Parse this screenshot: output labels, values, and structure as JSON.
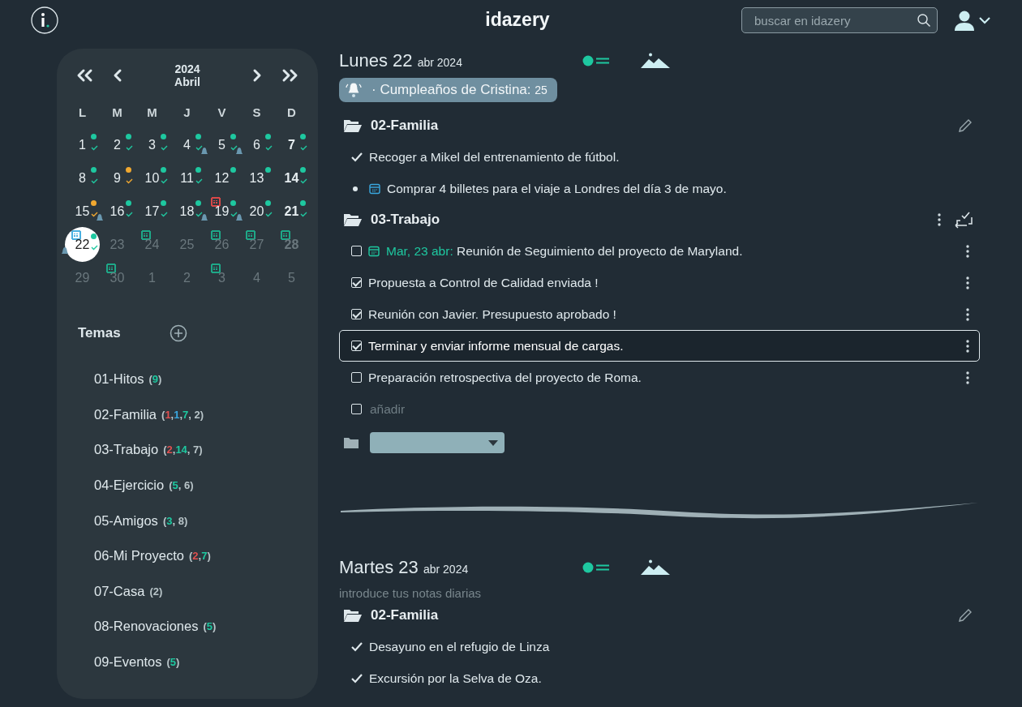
{
  "header": {
    "logo": "idazery",
    "search": {
      "placeholder": "buscar en idazery"
    }
  },
  "calendar": {
    "year": "2024",
    "month": "Abril",
    "weekdays": [
      "L",
      "M",
      "M",
      "J",
      "V",
      "S",
      "D"
    ],
    "days": [
      {
        "day": "1",
        "selected": false,
        "bold": false,
        "dim": false,
        "color": "#1ec8a0",
        "check": true,
        "bell": false
      },
      {
        "day": "2",
        "selected": false,
        "bold": false,
        "dim": false,
        "color": "#1ec8a0",
        "check": true,
        "bell": false
      },
      {
        "day": "3",
        "selected": false,
        "bold": false,
        "dim": false,
        "color": "#1ec8a0",
        "check": true,
        "bell": false
      },
      {
        "day": "4",
        "selected": false,
        "bold": false,
        "dim": false,
        "color": "#1ec8a0",
        "check": true,
        "bell": false
      },
      {
        "day": "5",
        "selected": false,
        "bold": false,
        "dim": false,
        "color": "#1ec8a0",
        "check": true,
        "bell": true
      },
      {
        "day": "6",
        "selected": false,
        "bold": false,
        "dim": false,
        "color": "#1ec8a0",
        "check": true,
        "bell": true
      },
      {
        "day": "7",
        "selected": false,
        "bold": true,
        "dim": false,
        "color": "#1ec8a0",
        "check": true,
        "bell": false
      },
      {
        "day": "8",
        "selected": false,
        "bold": false,
        "dim": false,
        "color": "#1ec8a0",
        "check": true,
        "bell": false
      },
      {
        "day": "9",
        "selected": false,
        "bold": false,
        "dim": false,
        "color": "#f0a830",
        "check": true,
        "bell": false
      },
      {
        "day": "10",
        "selected": false,
        "bold": false,
        "dim": false,
        "color": "#1ec8a0",
        "check": true,
        "bell": false
      },
      {
        "day": "11",
        "selected": false,
        "bold": false,
        "dim": false,
        "color": "#1ec8a0",
        "check": true,
        "bell": false
      },
      {
        "day": "12",
        "selected": false,
        "bold": false,
        "dim": false,
        "color": "#1ec8a0",
        "check": false,
        "bell": false
      },
      {
        "day": "13",
        "selected": false,
        "bold": false,
        "dim": false,
        "color": "#1ec8a0",
        "check": false,
        "bell": false
      },
      {
        "day": "14",
        "selected": false,
        "bold": true,
        "dim": false,
        "color": "#1ec8a0",
        "check": true,
        "bell": false
      },
      {
        "day": "15",
        "selected": false,
        "bold": false,
        "dim": false,
        "color": "#f0a830",
        "check": true,
        "bell": false
      },
      {
        "day": "16",
        "selected": false,
        "bold": false,
        "dim": false,
        "color": "#1ec8a0",
        "check": true,
        "bell": true
      },
      {
        "day": "17",
        "selected": false,
        "bold": false,
        "dim": false,
        "color": "#1ec8a0",
        "check": true,
        "bell": false
      },
      {
        "day": "18",
        "selected": false,
        "bold": false,
        "dim": false,
        "color": "#1ec8a0",
        "check": true,
        "bell": false
      },
      {
        "day": "19",
        "selected": false,
        "bold": false,
        "dim": false,
        "color": "#1ec8a0",
        "check": true,
        "bell": true,
        "note": {
          "color": "#d84848"
        }
      },
      {
        "day": "20",
        "selected": false,
        "bold": false,
        "dim": false,
        "color": "#1ec8a0",
        "check": true,
        "bell": true
      },
      {
        "day": "21",
        "selected": false,
        "bold": true,
        "dim": false,
        "color": "#1ec8a0",
        "check": true,
        "bell": false
      },
      {
        "day": "22",
        "selected": true,
        "bold": false,
        "dim": false,
        "color": "#1ec8a0",
        "check": true,
        "bell": true,
        "note": {
          "color": "#4ab0e0"
        }
      },
      {
        "day": "23",
        "selected": false,
        "bold": false,
        "dim": true,
        "check": false,
        "bell": false
      },
      {
        "day": "24",
        "selected": false,
        "bold": false,
        "dim": true,
        "check": false,
        "bell": false,
        "note": {
          "color": "#1ea888"
        }
      },
      {
        "day": "25",
        "selected": false,
        "bold": false,
        "dim": true,
        "check": false,
        "bell": false
      },
      {
        "day": "26",
        "selected": false,
        "bold": false,
        "dim": true,
        "check": false,
        "bell": false,
        "note": {
          "color": "#1ea888"
        }
      },
      {
        "day": "27",
        "selected": false,
        "bold": false,
        "dim": true,
        "check": false,
        "bell": false,
        "note": {
          "color": "#1ea888"
        }
      },
      {
        "day": "28",
        "selected": false,
        "bold": true,
        "dim": true,
        "check": false,
        "bell": false,
        "note": {
          "color": "#1ea888"
        }
      },
      {
        "day": "29",
        "selected": false,
        "bold": false,
        "dim": true,
        "check": false,
        "bell": false
      },
      {
        "day": "30",
        "selected": false,
        "bold": false,
        "dim": true,
        "check": false,
        "bell": false,
        "note": {
          "color": "#1ea888"
        }
      },
      {
        "day": "1",
        "selected": false,
        "bold": false,
        "dim": true,
        "check": false,
        "bell": false
      },
      {
        "day": "2",
        "selected": false,
        "bold": false,
        "dim": true,
        "check": false,
        "bell": false
      },
      {
        "day": "3",
        "selected": false,
        "bold": false,
        "dim": true,
        "check": false,
        "bell": false,
        "note": {
          "color": "#1ea888"
        }
      },
      {
        "day": "4",
        "selected": false,
        "bold": false,
        "dim": true,
        "check": false,
        "bell": false
      },
      {
        "day": "5",
        "selected": false,
        "bold": false,
        "dim": true,
        "check": false,
        "bell": false
      }
    ]
  },
  "topics": {
    "title": "Temas",
    "items": [
      {
        "name": "01-Hitos",
        "counts": [
          {
            "text": "("
          },
          {
            "text": "9",
            "color": "#1ec8a0"
          },
          {
            "text": ")"
          }
        ]
      },
      {
        "name": "02-Familia",
        "counts": [
          {
            "text": "("
          },
          {
            "text": "1",
            "color": "#e05050"
          },
          {
            "text": ","
          },
          {
            "text": "1",
            "color": "#3aa8e0"
          },
          {
            "text": ","
          },
          {
            "text": "7",
            "color": "#1ec8a0"
          },
          {
            "text": ", 2)"
          }
        ]
      },
      {
        "name": "03-Trabajo",
        "counts": [
          {
            "text": "("
          },
          {
            "text": "2",
            "color": "#e05050"
          },
          {
            "text": ","
          },
          {
            "text": "14",
            "color": "#1ec8a0"
          },
          {
            "text": ", 7)"
          }
        ]
      },
      {
        "name": "04-Ejercicio",
        "counts": [
          {
            "text": "("
          },
          {
            "text": "5",
            "color": "#1ec8a0"
          },
          {
            "text": ", 6)"
          }
        ]
      },
      {
        "name": "05-Amigos",
        "counts": [
          {
            "text": "("
          },
          {
            "text": "3",
            "color": "#1ec8a0"
          },
          {
            "text": ", 8)"
          }
        ]
      },
      {
        "name": "06-Mi Proyecto",
        "counts": [
          {
            "text": "("
          },
          {
            "text": "2",
            "color": "#e05050"
          },
          {
            "text": ","
          },
          {
            "text": "7",
            "color": "#1ec8a0"
          },
          {
            "text": ")"
          }
        ]
      },
      {
        "name": "07-Casa",
        "counts": [
          {
            "text": "(2)"
          }
        ]
      },
      {
        "name": "08-Renovaciones",
        "counts": [
          {
            "text": "("
          },
          {
            "text": "5",
            "color": "#1ec8a0"
          },
          {
            "text": ")"
          }
        ]
      },
      {
        "name": "09-Eventos",
        "counts": [
          {
            "text": "("
          },
          {
            "text": "5",
            "color": "#1ec8a0"
          },
          {
            "text": ")"
          }
        ]
      }
    ]
  },
  "days": [
    {
      "title": "Lunes 22",
      "subtitle": "abr 2024",
      "reminder": {
        "text": "· Cumpleaños de Cristina:",
        "value": "25"
      },
      "groups": [
        {
          "name": "02-Familia",
          "kind": "notes",
          "items": [
            {
              "kind": "done",
              "text": "Recoger a Mikel del entrenamiento de fútbol."
            },
            {
              "kind": "event",
              "text": "Comprar 4 billetes para el viaje a Londres del día 3 de mayo."
            }
          ]
        },
        {
          "name": "03-Trabajo",
          "kind": "tasks",
          "items": [
            {
              "kind": "task",
              "checked": false,
              "focused": false,
              "date": "Mar, 23 abr:",
              "text": "Reunión de Seguimiento del proyecto de Maryland."
            },
            {
              "kind": "task",
              "checked": true,
              "focused": false,
              "text": "Propuesta a Control de Calidad enviada !"
            },
            {
              "kind": "task",
              "checked": true,
              "focused": false,
              "text": "Reunión con Javier. Presupuesto aprobado !"
            },
            {
              "kind": "task",
              "checked": true,
              "focused": true,
              "text": "Terminar y enviar informe mensual de cargas."
            },
            {
              "kind": "task",
              "checked": false,
              "focused": false,
              "text": "Preparación retrospectiva del proyecto de Roma."
            },
            {
              "kind": "add",
              "checked": false,
              "placeholder": "añadir"
            }
          ]
        }
      ],
      "folder_select": true
    },
    {
      "title": "Martes 23",
      "subtitle": "abr 2024",
      "placeholder": "introduce tus notas diarias",
      "groups": [
        {
          "name": "02-Familia",
          "kind": "notes",
          "items": [
            {
              "kind": "done",
              "text": "Desayuno en el refugio de Linza"
            },
            {
              "kind": "done",
              "text": "Excursión por la Selva de Oza."
            }
          ]
        }
      ]
    }
  ]
}
